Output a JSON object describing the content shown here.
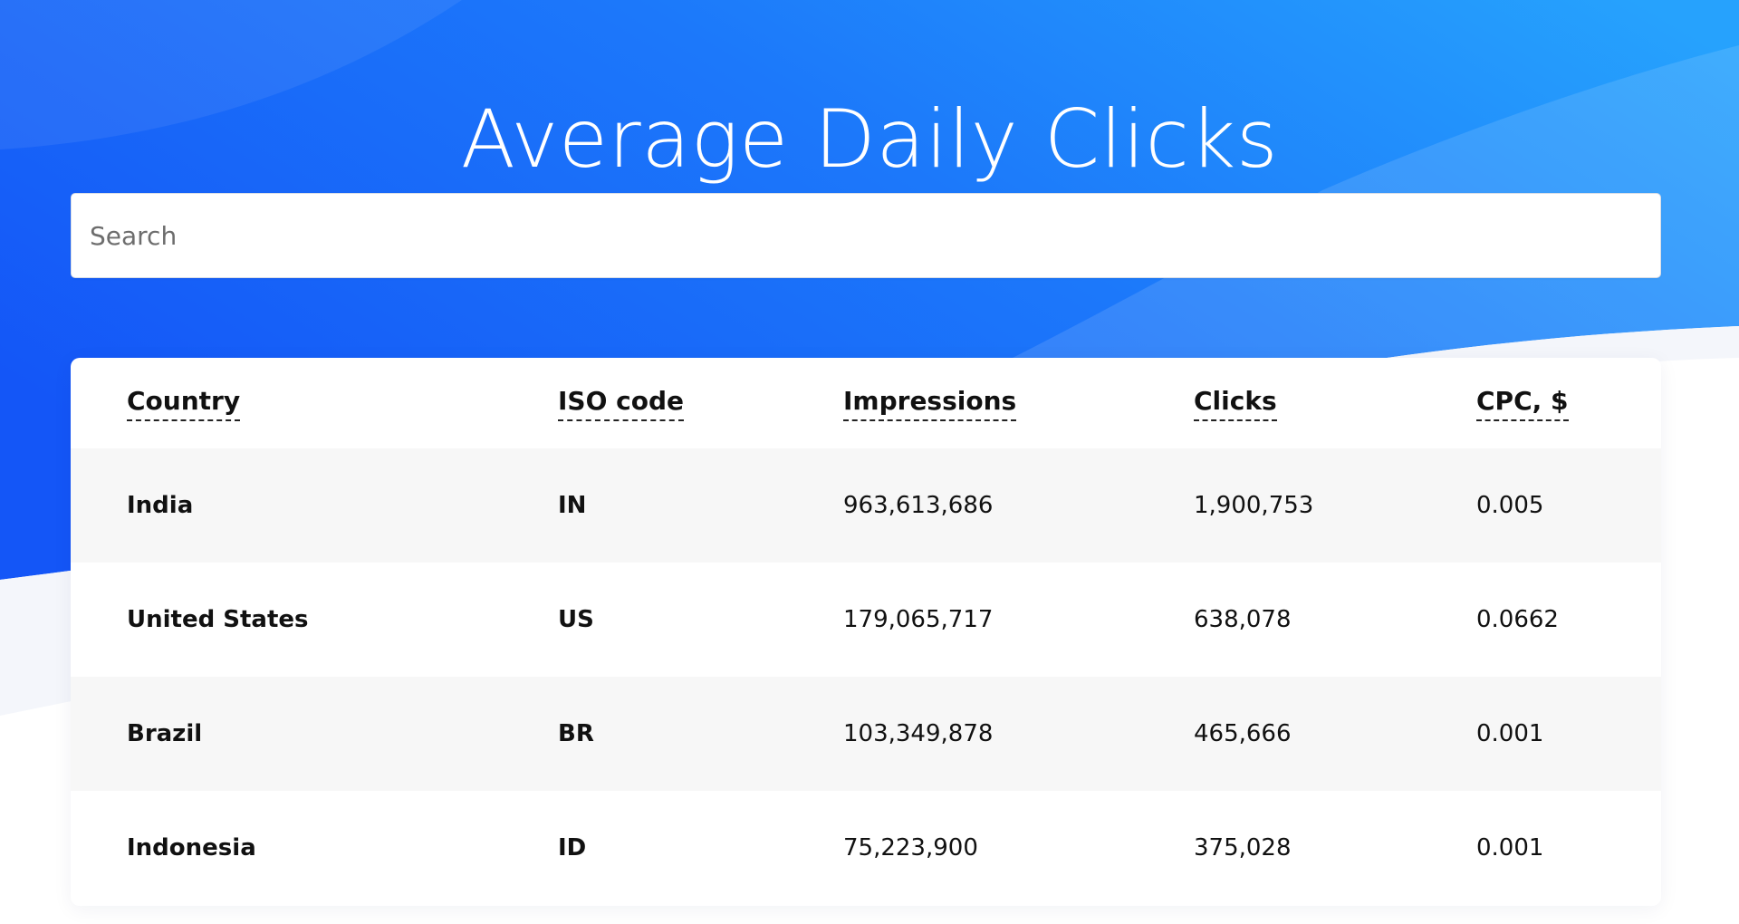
{
  "page": {
    "title": "Average Daily Clicks"
  },
  "search": {
    "placeholder": "Search",
    "value": ""
  },
  "table": {
    "columns": [
      "Country",
      "ISO code",
      "Impressions",
      "Clicks",
      "CPC, $"
    ],
    "rows": [
      {
        "country": "India",
        "iso": "IN",
        "impressions": "963,613,686",
        "clicks": "1,900,753",
        "cpc": "0.005"
      },
      {
        "country": "United States",
        "iso": "US",
        "impressions": "179,065,717",
        "clicks": "638,078",
        "cpc": "0.0662"
      },
      {
        "country": "Brazil",
        "iso": "BR",
        "impressions": "103,349,878",
        "clicks": "465,666",
        "cpc": "0.001"
      },
      {
        "country": "Indonesia",
        "iso": "ID",
        "impressions": "75,223,900",
        "clicks": "375,028",
        "cpc": "0.001"
      }
    ]
  },
  "colors": {
    "gradient_start": "#1358f7",
    "gradient_end": "#259ffc",
    "row_alt": "#f7f7f7",
    "text": "#111111"
  }
}
